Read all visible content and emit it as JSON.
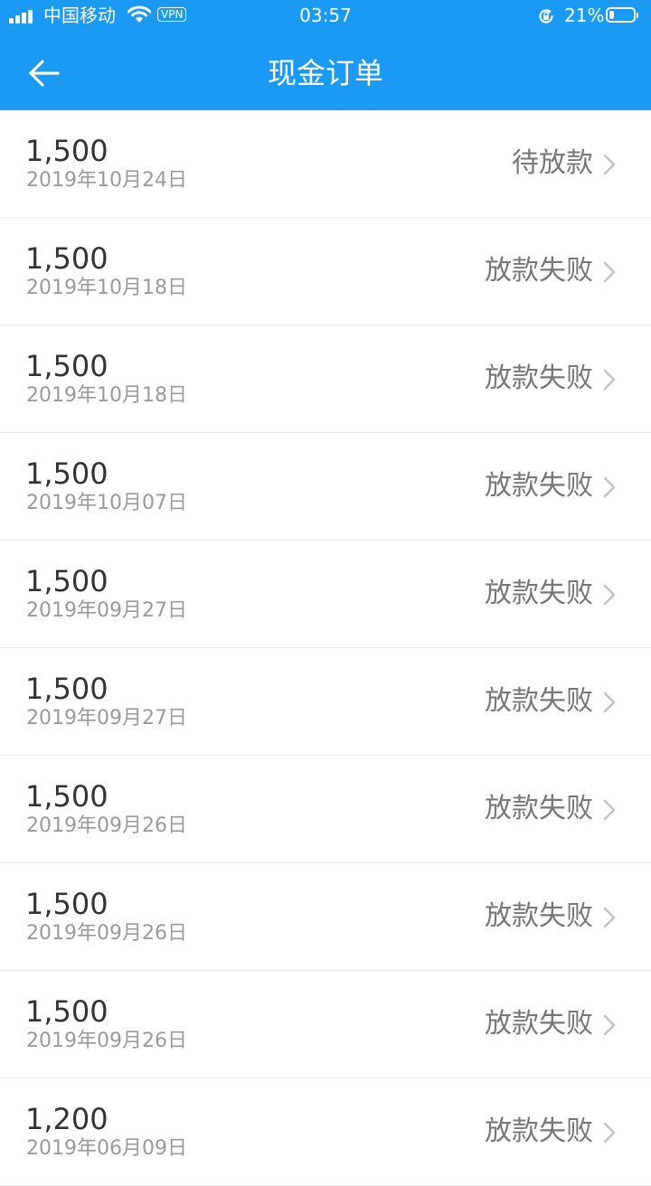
{
  "status_bar": {
    "carrier": "中国移动",
    "vpn_label": "VPN",
    "time": "03:57",
    "battery_percent": "21%",
    "battery_level": 0.21
  },
  "header": {
    "title": "现金订单",
    "background_color": "#1a9af2"
  },
  "orders": [
    {
      "amount": "1,500",
      "date": "2019年10月24日",
      "status": "待放款"
    },
    {
      "amount": "1,500",
      "date": "2019年10月18日",
      "status": "放款失败"
    },
    {
      "amount": "1,500",
      "date": "2019年10月18日",
      "status": "放款失败"
    },
    {
      "amount": "1,500",
      "date": "2019年10月07日",
      "status": "放款失败"
    },
    {
      "amount": "1,500",
      "date": "2019年09月27日",
      "status": "放款失败"
    },
    {
      "amount": "1,500",
      "date": "2019年09月27日",
      "status": "放款失败"
    },
    {
      "amount": "1,500",
      "date": "2019年09月26日",
      "status": "放款失败"
    },
    {
      "amount": "1,500",
      "date": "2019年09月26日",
      "status": "放款失败"
    },
    {
      "amount": "1,500",
      "date": "2019年09月26日",
      "status": "放款失败"
    },
    {
      "amount": "1,200",
      "date": "2019年06月09日",
      "status": "放款失败"
    }
  ]
}
